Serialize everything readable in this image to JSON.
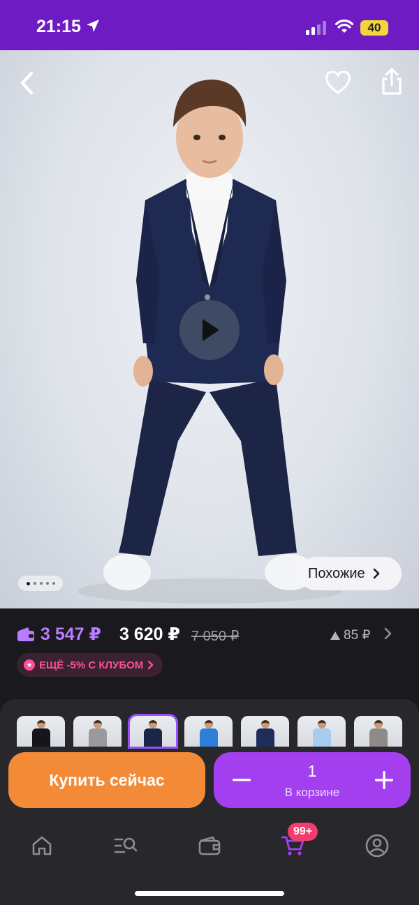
{
  "status_bar": {
    "time": "21:15",
    "battery": "40",
    "bg_color": "#6f1bc4"
  },
  "hero": {
    "back_icon": "chevron-left-icon",
    "favorite_icon": "heart-icon",
    "share_icon": "share-icon",
    "play_icon": "play-icon",
    "image_count": 5,
    "active_image": 1,
    "similar_label": "Похожие"
  },
  "price": {
    "wallet_price": "3 547 ₽",
    "price": "3 620 ₽",
    "old_price": "7 050 ₽",
    "points": "85 ₽",
    "club_offer": "ЕЩЁ -5% С КЛУБОМ",
    "accent_color": "#b77cff",
    "club_color": "#ff4f9a"
  },
  "variants": {
    "selected_index": 2,
    "items": [
      {
        "jacket_color": "#15161c"
      },
      {
        "jacket_color": "#9a9a9e"
      },
      {
        "jacket_color": "#1c2547"
      },
      {
        "jacket_color": "#2f7fd8"
      },
      {
        "jacket_color": "#1f2d58"
      },
      {
        "jacket_color": "#a8cbee"
      },
      {
        "jacket_color": "#8e8a86"
      }
    ]
  },
  "actions": {
    "buy_now_label": "Купить сейчас",
    "buy_now_color": "#f28a38",
    "cart_quantity": "1",
    "cart_label": "В корзине",
    "cart_color": "#a43ff0"
  },
  "tabbar": {
    "items": [
      "home-icon",
      "catalog-search-icon",
      "wallet-icon",
      "cart-icon",
      "profile-icon"
    ],
    "active": "cart-icon",
    "cart_badge": "99+",
    "badge_color": "#f23d6e"
  }
}
